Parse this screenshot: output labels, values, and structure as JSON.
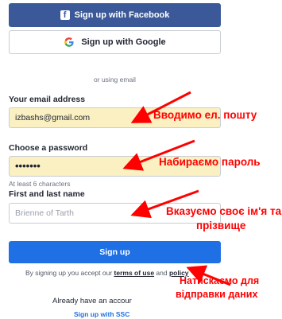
{
  "social": {
    "facebook_label": "Sign up with Facebook",
    "facebook_icon": "f",
    "google_label": "Sign up with Google"
  },
  "divider_text": "or using email",
  "email": {
    "label": "Your email address",
    "value": "izbashs@gmail.com"
  },
  "password": {
    "label": "Choose a password",
    "value": "•••••••",
    "hint": "At least 6 characters"
  },
  "name": {
    "label": "First and last name",
    "placeholder": "Brienne of Tarth"
  },
  "signup_label": "Sign up",
  "terms": {
    "prefix": "By signing up you accept our ",
    "terms_link": "terms of use",
    "and": " and ",
    "policy_link": "policy"
  },
  "already_account": "Already have an accour",
  "sso_link": "Sign up with SSC",
  "annotations": {
    "email": "Вводимо ел. пошту",
    "password": "Набираємо пароль",
    "name_line1": "Вказуємо своє ім'я та",
    "name_line2": "прізвище",
    "submit_line1": "Натискаємо для",
    "submit_line2": "відправки даних"
  },
  "colors": {
    "facebook": "#3b5998",
    "signup": "#1f6fe5",
    "annotation": "#ff0000",
    "filled_field": "#fbf0c1"
  }
}
